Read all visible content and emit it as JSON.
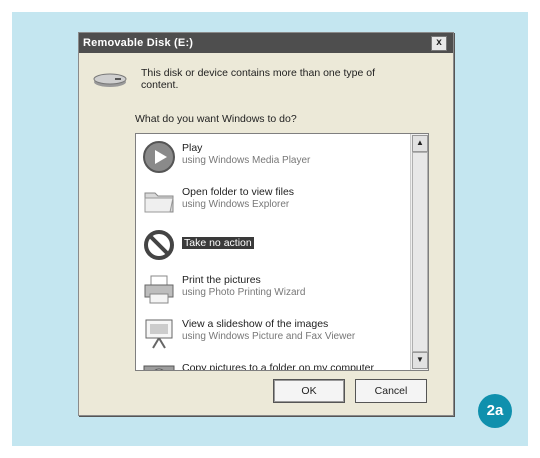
{
  "dialog": {
    "title": "Removable Disk (E:)",
    "close_glyph": "x",
    "message": "This disk or device contains more than one type of content.",
    "question": "What do you want Windows to do?"
  },
  "actions": [
    {
      "name": "Play",
      "sub": "using Windows Media Player",
      "icon": "play-icon"
    },
    {
      "name": "Open folder to view files",
      "sub": "using Windows Explorer",
      "icon": "folder-icon"
    },
    {
      "name": "Take no action",
      "sub": "",
      "icon": "no-action-icon"
    },
    {
      "name": "Print the pictures",
      "sub": "using Photo Printing Wizard",
      "icon": "printer-icon"
    },
    {
      "name": "View a slideshow of the images",
      "sub": "using Windows Picture and Fax Viewer",
      "icon": "slideshow-icon"
    },
    {
      "name": "Copy pictures to a folder on my computer",
      "sub": "",
      "icon": "camera-icon"
    }
  ],
  "selected_index": 2,
  "buttons": {
    "ok": "OK",
    "cancel": "Cancel"
  },
  "badge": "2a",
  "colors": {
    "panel": "#c4e6f0",
    "titlebar": "#4e4e4e",
    "badge": "#0f90ad"
  }
}
